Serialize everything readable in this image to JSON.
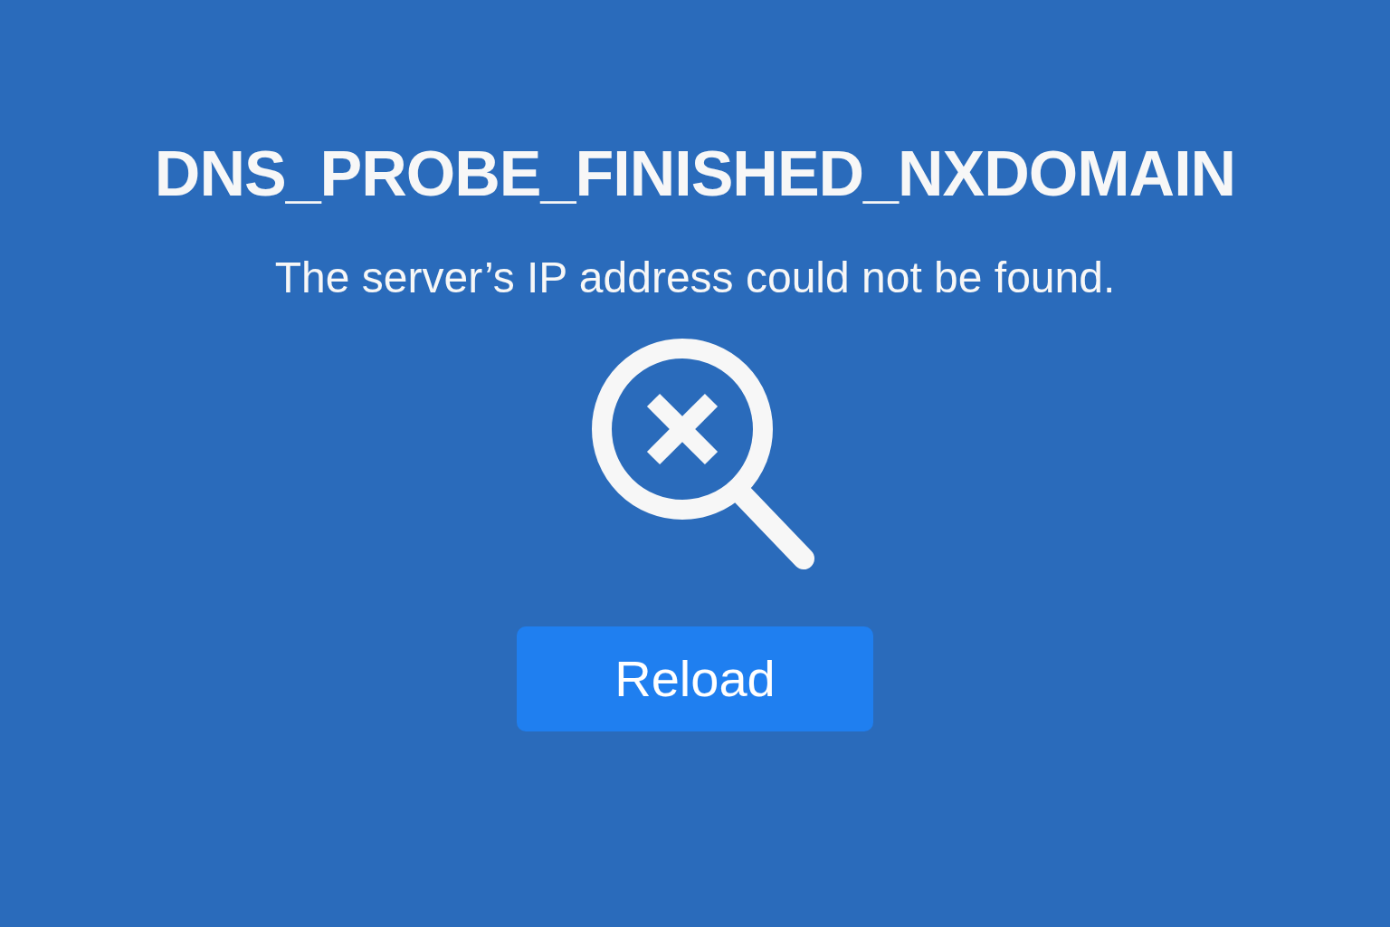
{
  "error": {
    "code": "DNS_PROBE_FINISHED_NXDOMAIN",
    "message": "The server’s IP address could not be found."
  },
  "buttons": [
    {
      "label": "Reload",
      "kind": "primary"
    }
  ]
}
